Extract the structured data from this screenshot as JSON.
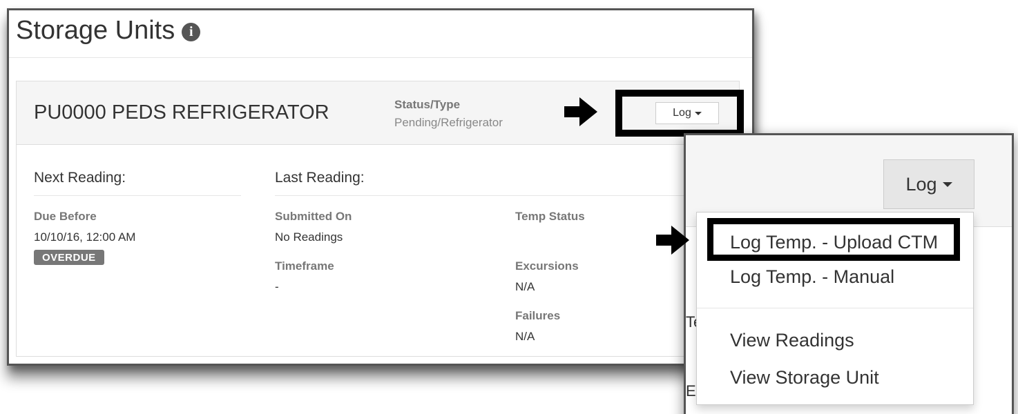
{
  "page": {
    "title": "Storage Units",
    "info_icon": "info-icon"
  },
  "unit": {
    "name": "PU0000 PEDS REFRIGERATOR",
    "status_type_label": "Status/Type",
    "status_type_value": "Pending/Refrigerator",
    "log_button_label": "Log"
  },
  "next_reading": {
    "title": "Next Reading:",
    "due_before_label": "Due Before",
    "due_before_value": "10/10/16, 12:00 AM",
    "status_badge": "OVERDUE"
  },
  "last_reading": {
    "title": "Last Reading:",
    "submitted_on_label": "Submitted On",
    "submitted_on_value": "No Readings",
    "timeframe_label": "Timeframe",
    "timeframe_value": "-",
    "temp_status_label": "Temp Status",
    "excursions_label": "Excursions",
    "excursions_value": "N/A",
    "failures_label": "Failures",
    "failures_value": "N/A"
  },
  "zoom": {
    "log_button_label": "Log",
    "partial_text_1": "Te",
    "partial_text_2": "E"
  },
  "dropdown": {
    "items": [
      {
        "label": "Log Temp. - Upload CTM"
      },
      {
        "label": "Log Temp. - Manual"
      },
      {
        "label": "View Readings"
      },
      {
        "label": "View Storage Unit"
      }
    ]
  },
  "icons": {
    "arrow": "arrow-right-icon",
    "caret": "caret-down-icon"
  },
  "colors": {
    "highlight_border": "#000000",
    "badge_background": "#777777",
    "header_background": "#f5f5f5"
  }
}
